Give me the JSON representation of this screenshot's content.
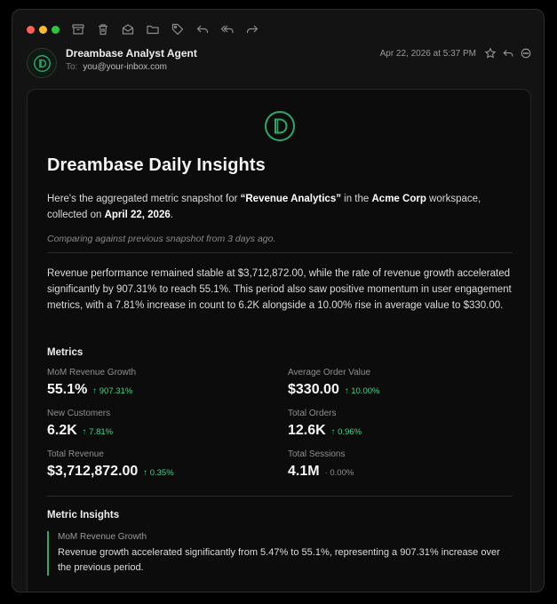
{
  "window": {
    "traffic_lights": [
      "close",
      "minimize",
      "maximize"
    ],
    "toolbar_icons": [
      "archive-icon",
      "trash-icon",
      "mark-read-icon",
      "folder-icon",
      "tag-icon",
      "reply-icon",
      "reply-all-icon",
      "forward-icon"
    ]
  },
  "header": {
    "sender": "Dreambase Analyst Agent",
    "to_label": "To:",
    "to_value": "you@your-inbox.com",
    "date": "Apr 22, 2026 at 5:37 PM",
    "icons": [
      "star-icon",
      "reply-icon",
      "more-icon"
    ]
  },
  "email": {
    "title": "Dreambase Daily Insights",
    "intro": {
      "part1": "Here's the aggregated metric snapshot for ",
      "report": "“Revenue Analytics”",
      "part2": " in the ",
      "workspace": "Acme Corp",
      "part3": " workspace, collected on ",
      "date": "April 22, 2026",
      "part4": "."
    },
    "comparing": "Comparing against previous snapshot from 3 days ago.",
    "summary": "Revenue performance remained stable at $3,712,872.00, while the rate of revenue growth accelerated significantly by 907.31% to reach 55.1%. This period also saw positive momentum in user engagement metrics, with a 7.81% increase in count to 6.2K alongside a 10.00% rise in average value to $330.00.",
    "metrics_heading": "Metrics",
    "metrics": [
      {
        "label": "MoM Revenue Growth",
        "value": "55.1%",
        "delta": "↑ 907.31%",
        "trend": "up"
      },
      {
        "label": "Average Order Value",
        "value": "$330.00",
        "delta": "↑ 10.00%",
        "trend": "up"
      },
      {
        "label": "New Customers",
        "value": "6.2K",
        "delta": "↑ 7.81%",
        "trend": "up"
      },
      {
        "label": "Total Orders",
        "value": "12.6K",
        "delta": "↑ 0.96%",
        "trend": "up"
      },
      {
        "label": "Total Revenue",
        "value": "$3,712,872.00",
        "delta": "↑ 0.35%",
        "trend": "up"
      },
      {
        "label": "Total Sessions",
        "value": "4.1M",
        "delta": "· 0.00%",
        "trend": "flat"
      }
    ],
    "insights_heading": "Metric Insights",
    "insights": [
      {
        "title": "MoM Revenue Growth",
        "text": "Revenue growth accelerated significantly from 5.47% to 55.1%, representing a 907.31% increase over the previous period."
      }
    ]
  },
  "colors": {
    "accent_green": "#3dd68c",
    "brand_green": "#2fa86a",
    "background": "#0c0c0c"
  }
}
